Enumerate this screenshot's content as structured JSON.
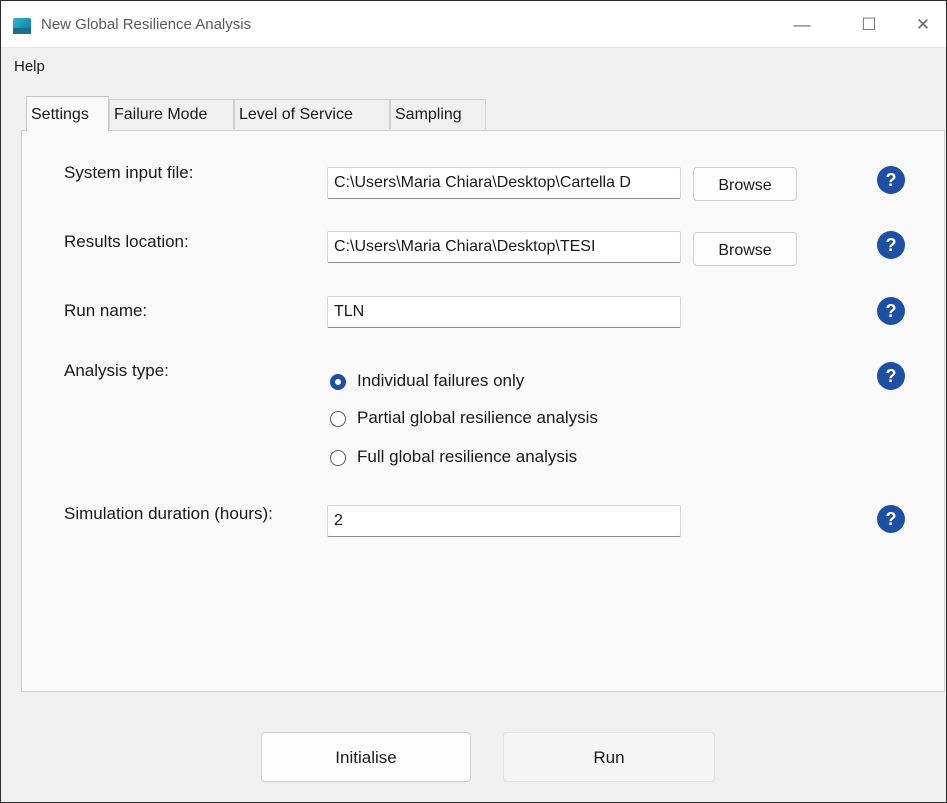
{
  "window": {
    "title": "New Global Resilience Analysis",
    "minimize_glyph": "—",
    "maximize_glyph": "☐",
    "close_glyph": "✕"
  },
  "menu": {
    "help_label": "Help"
  },
  "tabs": [
    {
      "label": "Settings",
      "active": true
    },
    {
      "label": "Failure Mode",
      "active": false
    },
    {
      "label": "Level of Service",
      "active": false
    },
    {
      "label": "Sampling",
      "active": false
    }
  ],
  "settings": {
    "system_input": {
      "label": "System input file:",
      "value": "C:\\Users\\Maria Chiara\\Desktop\\Cartella D",
      "browse_label": "Browse"
    },
    "results_location": {
      "label": "Results location:",
      "value": "C:\\Users\\Maria Chiara\\Desktop\\TESI",
      "browse_label": "Browse"
    },
    "run_name": {
      "label": "Run name:",
      "value": "TLN"
    },
    "analysis_type": {
      "label": "Analysis type:",
      "options": [
        {
          "label": "Individual failures only",
          "selected": true
        },
        {
          "label": "Partial global resilience analysis",
          "selected": false
        },
        {
          "label": "Full global resilience analysis",
          "selected": false
        }
      ]
    },
    "simulation_duration": {
      "label": "Simulation duration (hours):",
      "value": "2"
    }
  },
  "buttons": {
    "initialise_label": "Initialise",
    "run_label": "Run"
  },
  "icons": {
    "help": "question-circle-icon",
    "app": "app-icon"
  },
  "colors": {
    "help_icon": "#1f4fa3",
    "radio_selected": "#1f4fa3",
    "panel_bg": "#f9f9f9",
    "window_bg": "#f0f0f0"
  }
}
